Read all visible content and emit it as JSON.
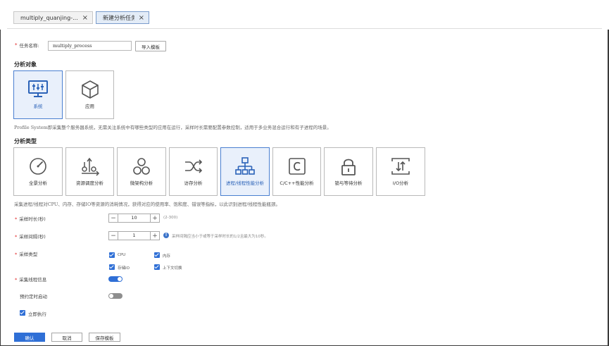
{
  "tabs": [
    {
      "label": "multiply_quanjing-...",
      "close": "×"
    },
    {
      "label": "新建分析任务",
      "close": "×"
    }
  ],
  "task": {
    "label": "任务名称:",
    "value": "multiply_process",
    "import_button": "导入模板"
  },
  "analysis_object": {
    "title": "分析对象",
    "options": [
      {
        "label": "系统",
        "icon": "monitor-icon",
        "selected": true
      },
      {
        "label": "应用",
        "icon": "cube-icon",
        "selected": false
      }
    ],
    "description": "Profile System即采集整个服务器系统，无需关注系统中有哪些类型的应用在运行，采样时长需要配置参数控制，适用于多业务混合运行和有子进程的场景。"
  },
  "analysis_type": {
    "title": "分析类型",
    "options": [
      {
        "label": "全景分析",
        "icon": "gauge-icon",
        "selected": false
      },
      {
        "label": "资源调度分析",
        "icon": "resource-schedule-icon",
        "selected": false
      },
      {
        "label": "微架构分析",
        "icon": "microarch-icon",
        "selected": false
      },
      {
        "label": "访存分析",
        "icon": "shuffle-icon",
        "selected": false
      },
      {
        "label": "进程/线程性能分析",
        "icon": "hierarchy-icon",
        "selected": true
      },
      {
        "label": "C/C++性能分析",
        "icon": "c-letter-icon",
        "selected": false
      },
      {
        "label": "锁与等待分析",
        "icon": "lock-icon",
        "selected": false
      },
      {
        "label": "I/O分析",
        "icon": "io-arrows-icon",
        "selected": false
      }
    ],
    "description": "采集进程/线程对CPU、内存、存储IO等资源的消耗情况，获得对应的使用率、饱和度、错误等指标，以此识别进程/线程性能瓶颈。"
  },
  "form": {
    "duration": {
      "label": "采样时长(秒)",
      "value": "10",
      "minus": "−",
      "plus": "+",
      "hint": "(2-300)"
    },
    "interval": {
      "label": "采样间隔(秒)",
      "value": "1",
      "minus": "−",
      "plus": "+",
      "hint": "采样间隔应当小于或等于采样时长的1/2且最大为10秒。"
    },
    "sample_type": {
      "label": "采样类型",
      "options": [
        "CPU",
        "内存",
        "存储IO",
        "上下文切换"
      ]
    },
    "thread_info": {
      "label": "采集线程信息",
      "on": true
    },
    "scheduled": {
      "label": "预约定时启动",
      "on": false
    },
    "immediate": {
      "label": "立即执行",
      "checked": true
    }
  },
  "buttons": {
    "confirm": "确认",
    "cancel": "取消",
    "save_template": "保存模板"
  },
  "colors": {
    "accent": "#2f6fd6",
    "required": "#e02020",
    "selected_bg": "#e9f0fb"
  }
}
